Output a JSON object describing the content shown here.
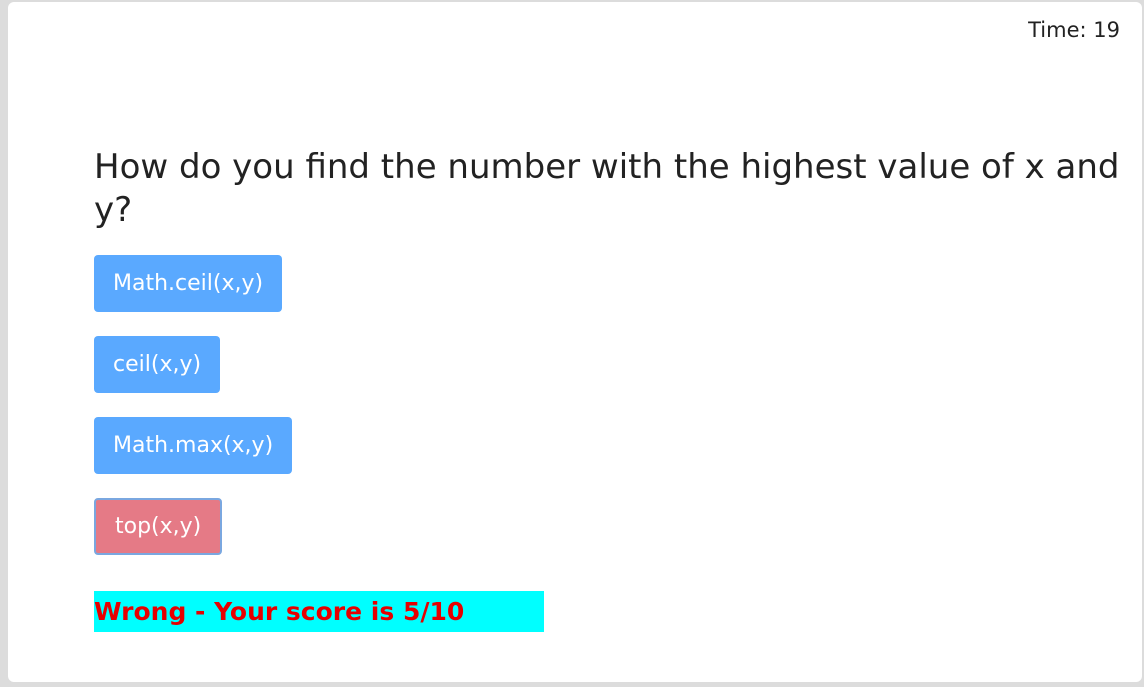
{
  "timer": {
    "label": "Time: 19"
  },
  "question": {
    "text": "How do you find the number with the highest value of x and y?"
  },
  "answers": [
    {
      "label": "Math.ceil(x,y)",
      "state": "default"
    },
    {
      "label": "ceil(x,y)",
      "state": "default"
    },
    {
      "label": "Math.max(x,y)",
      "state": "default"
    },
    {
      "label": "top(x,y)",
      "state": "wrong"
    }
  ],
  "feedback": {
    "text": "Wrong - Your score is 5/10"
  },
  "colors": {
    "answer_default": "#5aa9ff",
    "answer_wrong": "#e57a86",
    "feedback_bg": "#00ffff",
    "feedback_text": "#e60000"
  }
}
